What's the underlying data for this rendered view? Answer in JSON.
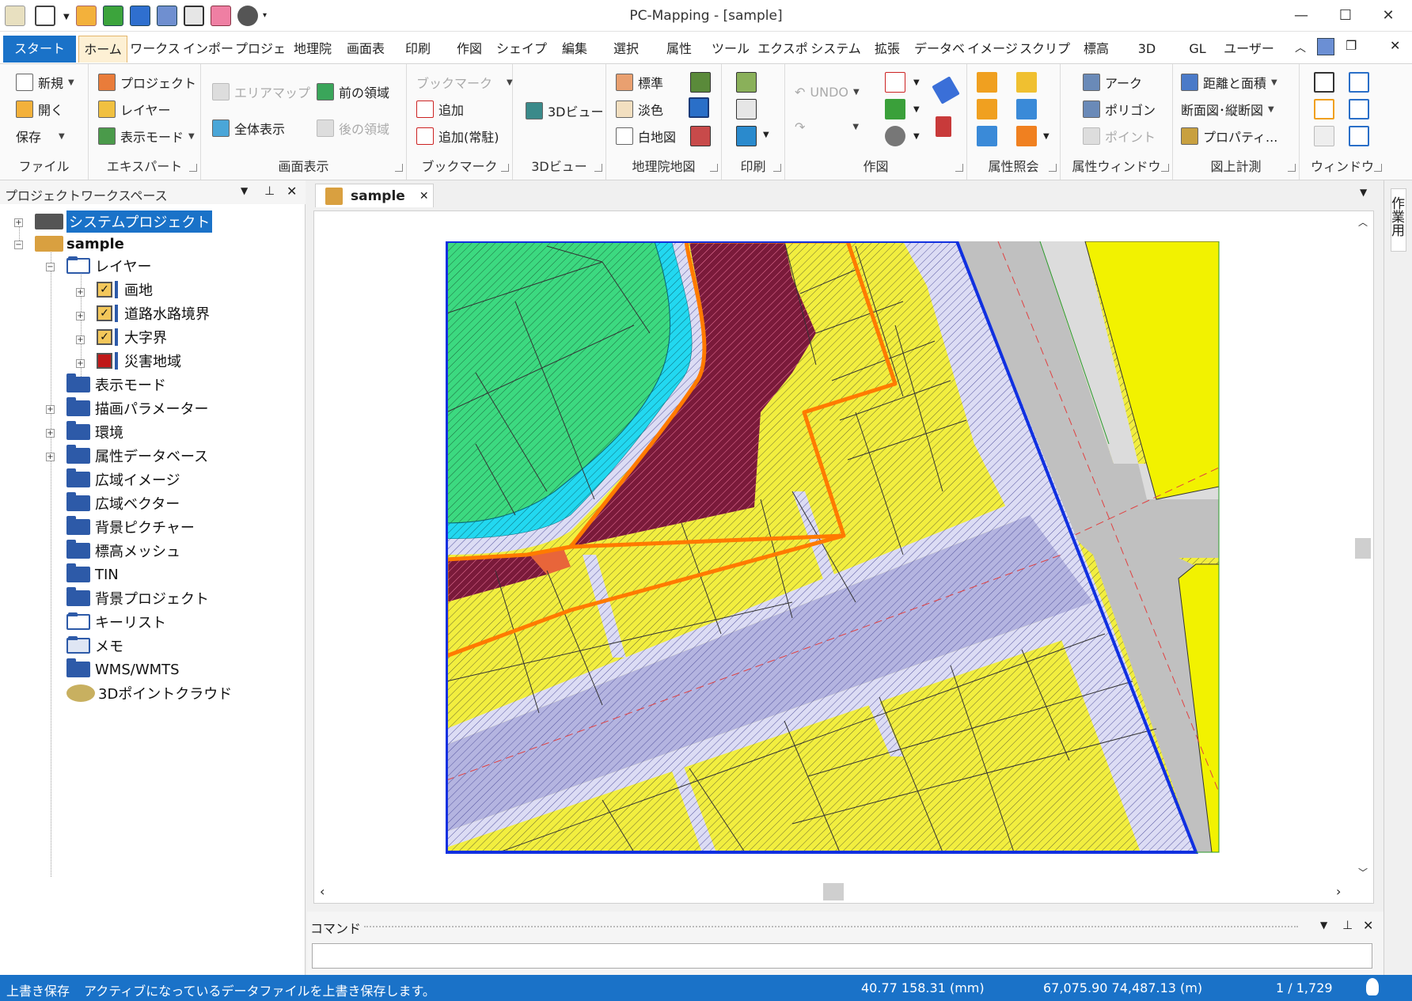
{
  "window": {
    "title": "PC-Mapping - [sample]",
    "minimize": "—",
    "maximize": "☐",
    "close": "✕"
  },
  "tabs": [
    "スタート",
    "ホーム",
    "ワークス",
    "インポー",
    "プロジェ",
    "地理院",
    "画面表",
    "印刷",
    "作図",
    "シェイプ",
    "編集",
    "選択",
    "属性",
    "ツール",
    "エクスポ",
    "システム",
    "拡張",
    "データベ",
    "イメージ",
    "スクリプ",
    "標高",
    "3D",
    "GL",
    "ユーザー"
  ],
  "ribbon": {
    "file": {
      "label": "ファイル",
      "new": "新規",
      "open": "開く",
      "save": "保存"
    },
    "expert": {
      "label": "エキスパート",
      "project": "プロジェクト",
      "layer": "レイヤー",
      "display_mode": "表示モード"
    },
    "view": {
      "label": "画面表示",
      "area_map": "エリアマップ",
      "full_view": "全体表示",
      "prev_area": "前の領域",
      "next_area": "後の領域"
    },
    "bookmark": {
      "label": "ブックマーク",
      "bookmark": "ブックマーク",
      "add": "追加",
      "add_resident": "追加(常駐)"
    },
    "view3d": {
      "label": "3Dビュー",
      "button": "3Dビュー"
    },
    "gsi": {
      "label": "地理院地図",
      "standard": "標準",
      "pale": "淡色",
      "blank": "白地図"
    },
    "print": {
      "label": "印刷"
    },
    "draw": {
      "label": "作図",
      "undo": "UNDO"
    },
    "attr_query": {
      "label": "属性照会"
    },
    "attr_window": {
      "label": "属性ウィンドウ",
      "arc": "アーク",
      "polygon": "ポリゴン",
      "point": "ポイント"
    },
    "measure": {
      "label": "図上計測",
      "dist_area": "距離と面積",
      "section": "断面図･縦断図",
      "property": "プロパティ..."
    },
    "window": {
      "label": "ウィンドウ"
    }
  },
  "workspace": {
    "title": "プロジェクトワークスペース",
    "items": [
      {
        "label": "システムプロジェクト"
      },
      {
        "label": "sample"
      },
      {
        "label": "レイヤー"
      },
      {
        "label": "画地"
      },
      {
        "label": "道路水路境界"
      },
      {
        "label": "大字界"
      },
      {
        "label": "災害地域"
      },
      {
        "label": "表示モード"
      },
      {
        "label": "描画パラメーター"
      },
      {
        "label": "環境"
      },
      {
        "label": "属性データベース"
      },
      {
        "label": "広域イメージ"
      },
      {
        "label": "広域ベクター"
      },
      {
        "label": "背景ピクチャー"
      },
      {
        "label": "標高メッシュ"
      },
      {
        "label": "TIN"
      },
      {
        "label": "背景プロジェクト"
      },
      {
        "label": "キーリスト"
      },
      {
        "label": "メモ"
      },
      {
        "label": "WMS/WMTS"
      },
      {
        "label": "3Dポイントクラウド"
      }
    ]
  },
  "document": {
    "tab": "sample",
    "close": "✕"
  },
  "command": {
    "title": "コマンド"
  },
  "side_tab": "作業用",
  "status": {
    "action": "上書き保存",
    "message": "アクティブになっているデータファイルを上書き保存します。",
    "mm_coords": "40.77 158.31 (mm)",
    "m_coords": "67,075.90 74,487.13 (m)",
    "scale": "1 / 1,729"
  },
  "colors": {
    "accent": "#1a72c8",
    "parcel": "#f2ee3f",
    "road": "#c0c0c0",
    "boundary": "#1030e0",
    "disaster": "#ff7a00",
    "green": "#3cd980",
    "water": "#22d8f0"
  }
}
